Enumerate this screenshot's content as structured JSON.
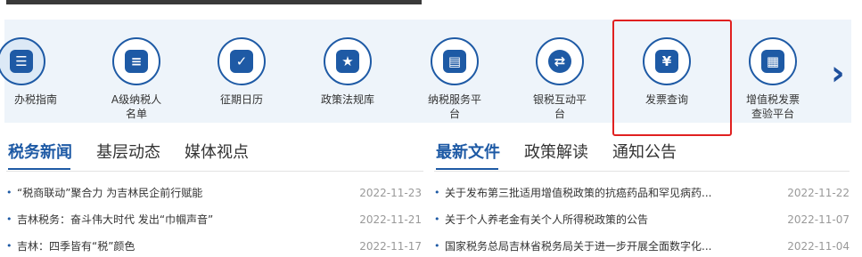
{
  "services": [
    {
      "label": "办税指南",
      "icon": "tax-guide-icon",
      "glyph": "☰"
    },
    {
      "label": "A级纳税人名单",
      "icon": "taxpayer-list-icon",
      "glyph": "≡"
    },
    {
      "label": "征期日历",
      "icon": "calendar-icon",
      "glyph": "✓"
    },
    {
      "label": "政策法规库",
      "icon": "policy-book-icon",
      "glyph": "★"
    },
    {
      "label": "纳税服务平台",
      "icon": "service-platform-icon",
      "glyph": "▤"
    },
    {
      "label": "银税互动平台",
      "icon": "bank-tax-icon",
      "glyph": "⇄"
    },
    {
      "label": "发票查询",
      "icon": "invoice-query-icon",
      "glyph": "¥"
    },
    {
      "label": "增值税发票查验平台",
      "icon": "vat-invoice-icon",
      "glyph": "▦"
    }
  ],
  "left_tabs": [
    "税务新闻",
    "基层动态",
    "媒体视点"
  ],
  "right_tabs": [
    "最新文件",
    "政策解读",
    "通知公告"
  ],
  "left_news": [
    {
      "title": "“税商联动”聚合力 为吉林民企前行赋能",
      "date": "2022-11-23"
    },
    {
      "title": "吉林税务：奋斗伟大时代 发出“巾帼声音”",
      "date": "2022-11-21"
    },
    {
      "title": "吉林：四季皆有“税”颜色",
      "date": "2022-11-17"
    }
  ],
  "right_news": [
    {
      "title": "关于发布第三批适用增值税政策的抗癌药品和罕见病药...",
      "date": "2022-11-22"
    },
    {
      "title": "关于个人养老金有关个人所得税政策的公告",
      "date": "2022-11-07"
    },
    {
      "title": "国家税务总局吉林省税务局关于进一步开展全面数字化...",
      "date": "2022-11-04"
    }
  ],
  "bullet": "•",
  "nav": {
    "prev": "‹",
    "next": "›"
  }
}
